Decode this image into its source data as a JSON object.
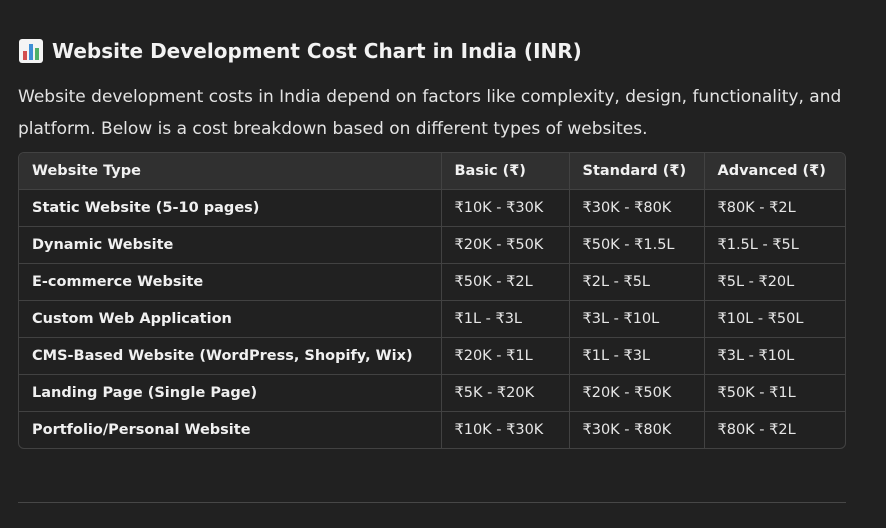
{
  "heading": {
    "icon": "bar-chart-icon",
    "title": "Website Development Cost Chart in India (INR)"
  },
  "intro": "Website development costs in India depend on factors like complexity, design, functionality, and platform. Below is a cost breakdown based on different types of websites.",
  "table": {
    "headers": [
      "Website Type",
      "Basic (₹)",
      "Standard (₹)",
      "Advanced (₹)"
    ],
    "rows": [
      [
        "Static Website (5-10 pages)",
        "₹10K - ₹30K",
        "₹30K - ₹80K",
        "₹80K - ₹2L"
      ],
      [
        "Dynamic Website",
        "₹20K - ₹50K",
        "₹50K - ₹1.5L",
        "₹1.5L - ₹5L"
      ],
      [
        "E-commerce Website",
        "₹50K - ₹2L",
        "₹2L - ₹5L",
        "₹5L - ₹20L"
      ],
      [
        "Custom Web Application",
        "₹1L - ₹3L",
        "₹3L - ₹10L",
        "₹10L - ₹50L"
      ],
      [
        "CMS-Based Website (WordPress, Shopify, Wix)",
        "₹20K - ₹1L",
        "₹1L - ₹3L",
        "₹3L - ₹10L"
      ],
      [
        "Landing Page (Single Page)",
        "₹5K - ₹20K",
        "₹20K - ₹50K",
        "₹50K - ₹1L"
      ],
      [
        "Portfolio/Personal Website",
        "₹10K - ₹30K",
        "₹30K - ₹80K",
        "₹80K - ₹2L"
      ]
    ]
  },
  "colors": {
    "background": "#212121",
    "header_row": "#303030",
    "border": "#424242",
    "icon_bars": [
      "#d24f4f",
      "#3f8fd6",
      "#4fb06a"
    ]
  }
}
